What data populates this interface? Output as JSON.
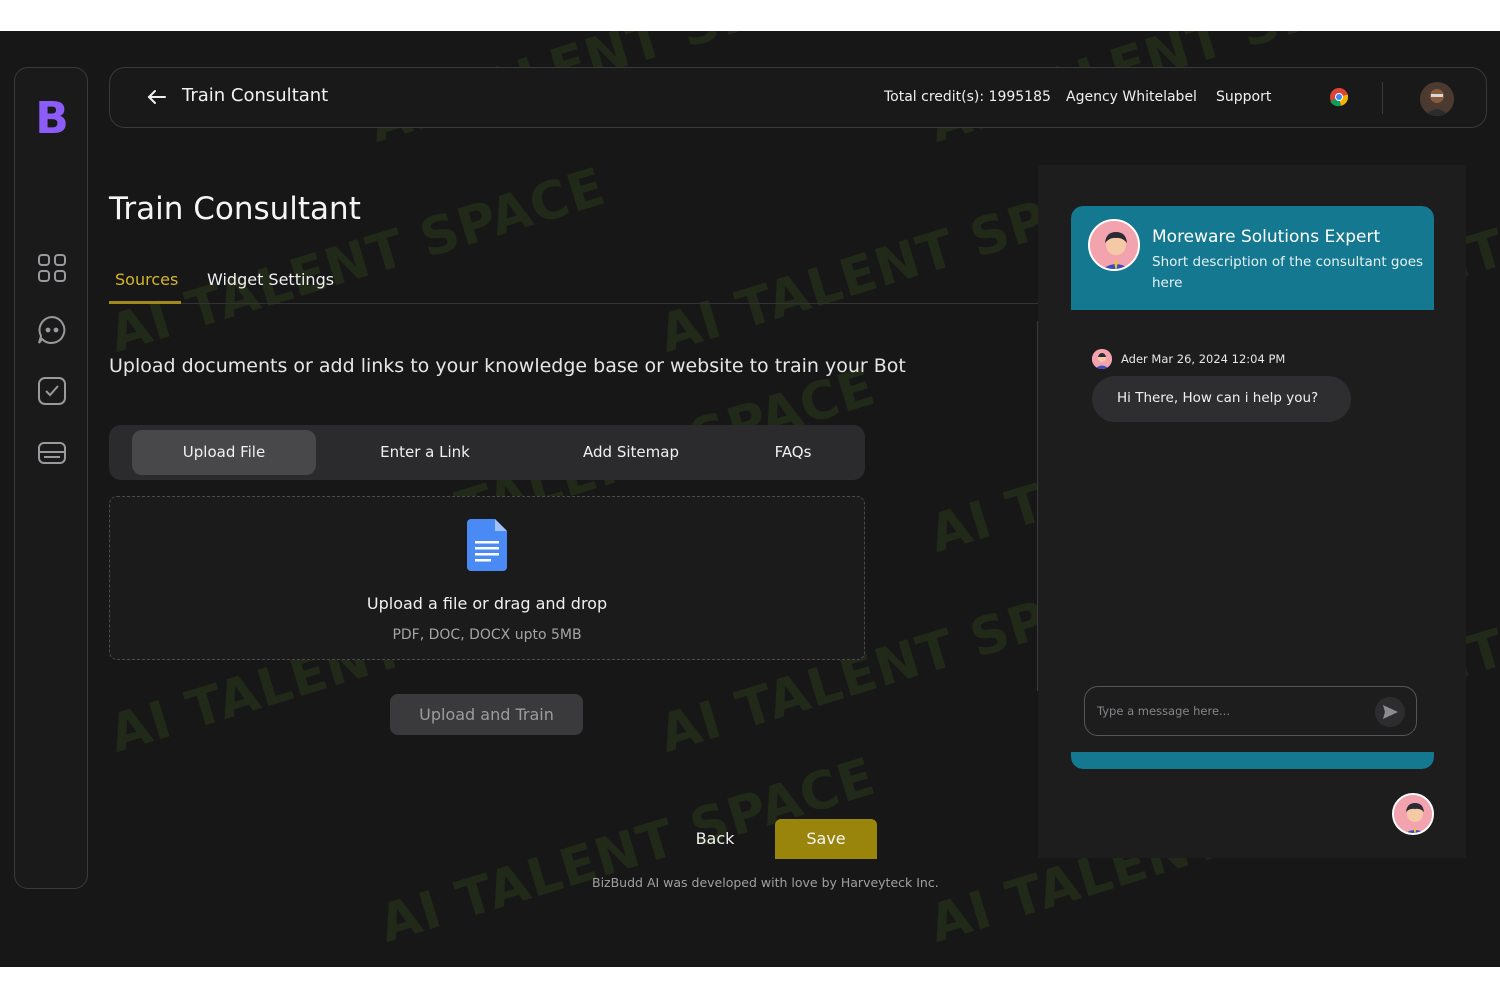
{
  "brand": {
    "logo_text": "B",
    "accent": "#8b5cf6"
  },
  "sidebar": {
    "icons": [
      "dashboard-grid-icon",
      "chat-bubble-icon",
      "checkbox-icon",
      "card-icon"
    ]
  },
  "topbar": {
    "title": "Train Consultant",
    "credits": "Total credit(s): 1995185",
    "agency": "Agency Whitelabel",
    "support": "Support"
  },
  "main": {
    "page_title": "Train Consultant",
    "tabs": [
      {
        "label": "Sources",
        "active": true
      },
      {
        "label": "Widget Settings",
        "active": false
      }
    ],
    "description": "Upload documents or add links to your knowledge base or website to train your Bot",
    "segments": [
      {
        "label": "Upload File",
        "active": true
      },
      {
        "label": "Enter a Link",
        "active": false
      },
      {
        "label": "Add Sitemap",
        "active": false
      },
      {
        "label": "FAQs",
        "active": false
      }
    ],
    "dropzone": {
      "text": "Upload a file or drag and drop",
      "subtext": "PDF, DOC, DOCX upto 5MB"
    },
    "upload_button": "Upload and Train",
    "back_button": "Back",
    "save_button": "Save",
    "footer": "BizBudd AI was developed with love by Harveyteck Inc."
  },
  "chat_preview": {
    "header_color": "#157891",
    "name": "Moreware Solutions Expert",
    "description": "Short description of the consultant goes here",
    "message_meta": "Ader Mar 26, 2024 12:04 PM",
    "message_text": "Hi There, How can i help you?",
    "input_placeholder": "Type a message here..."
  },
  "watermark": {
    "text": "AI TALENT SPACE"
  },
  "colors": {
    "save": "#9a850c",
    "active_tab": "#d4b62c",
    "background": "#171718"
  }
}
